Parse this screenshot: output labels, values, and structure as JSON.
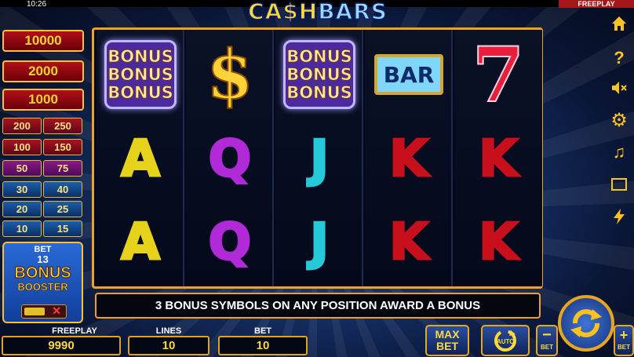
{
  "status": {
    "time": "10:26",
    "mode_badge": "FREEPLAY"
  },
  "logo": {
    "part1": "CA$H",
    "part2": "BARS"
  },
  "paytable": {
    "big": [
      "10000",
      "2000",
      "1000"
    ],
    "small": [
      [
        "200",
        "250"
      ],
      [
        "100",
        "150"
      ],
      [
        "50",
        "75"
      ],
      [
        "30",
        "40"
      ],
      [
        "20",
        "25"
      ],
      [
        "10",
        "15"
      ]
    ]
  },
  "booster": {
    "bet_label": "BET",
    "bet_value": "13",
    "line1": "BONUS",
    "line2": "BOOSTER",
    "toggle_off": "✕"
  },
  "reels": [
    [
      "BONUS BONUS BONUS",
      "A",
      "A"
    ],
    [
      "$",
      "Q",
      "Q"
    ],
    [
      "BONUS BONUS BONUS",
      "J",
      "J"
    ],
    [
      "BAR",
      "K",
      "K"
    ],
    [
      "7",
      "K",
      "K"
    ]
  ],
  "symbol_colors": {
    "A": "#e6d21a",
    "Q": "#b02ad8",
    "J": "#25c9d8",
    "K": "#c8101c"
  },
  "message": "3 BONUS SYMBOLS ON ANY POSITION AWARD A BONUS",
  "bottom": {
    "freeplay_label": "FREEPLAY",
    "freeplay_value": "9990",
    "lines_label": "LINES",
    "lines_value": "10",
    "bet_label": "BET",
    "bet_value": "10"
  },
  "buttons": {
    "max_bet_line1": "MAX",
    "max_bet_line2": "BET",
    "auto": "AUTO",
    "minus_bet": "BET",
    "plus_bet": "BET"
  },
  "sidebar_icons": [
    "home-icon",
    "help-icon",
    "sound-off-icon",
    "settings-icon",
    "music-icon",
    "fullscreen-icon",
    "turbo-icon"
  ]
}
